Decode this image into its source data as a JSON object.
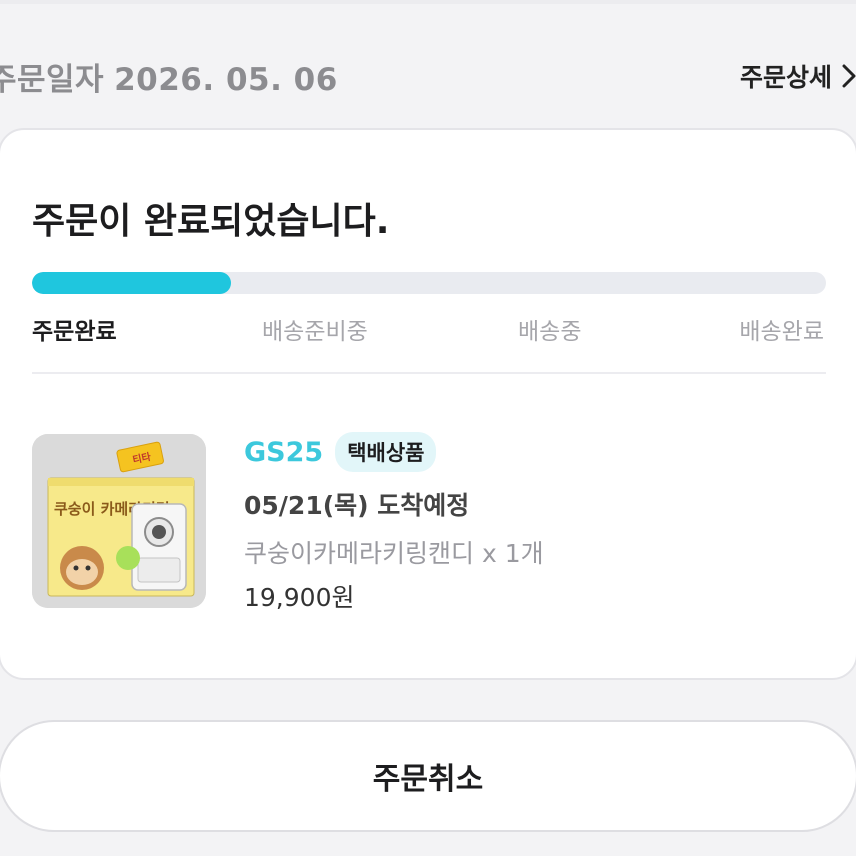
{
  "header": {
    "order_date_label": "주문일자",
    "order_date_value": "2026. 05. 06",
    "detail_link": "주문상세"
  },
  "status": {
    "title": "주문이 완료되었습니다.",
    "progress_fraction": 0.25,
    "progress_color": "#1fc6de",
    "steps": [
      "주문완료",
      "배송준비중",
      "배송중",
      "배송완료"
    ],
    "active_step": 0
  },
  "item": {
    "store": "GS25",
    "shipping_badge": "택배상품",
    "arrival": "05/21(목) 도착예정",
    "product_name": "쿠숭이카메라키링캔디 x 1개",
    "price": "19,900원",
    "box_text": "쿠숭이 카메라키링"
  },
  "actions": {
    "cancel_label": "주문취소"
  },
  "colors": {
    "accent": "#1fc6de",
    "store": "#3cc8dc",
    "badge_bg": "#e2f6f9",
    "page_bg": "#f3f3f5"
  }
}
